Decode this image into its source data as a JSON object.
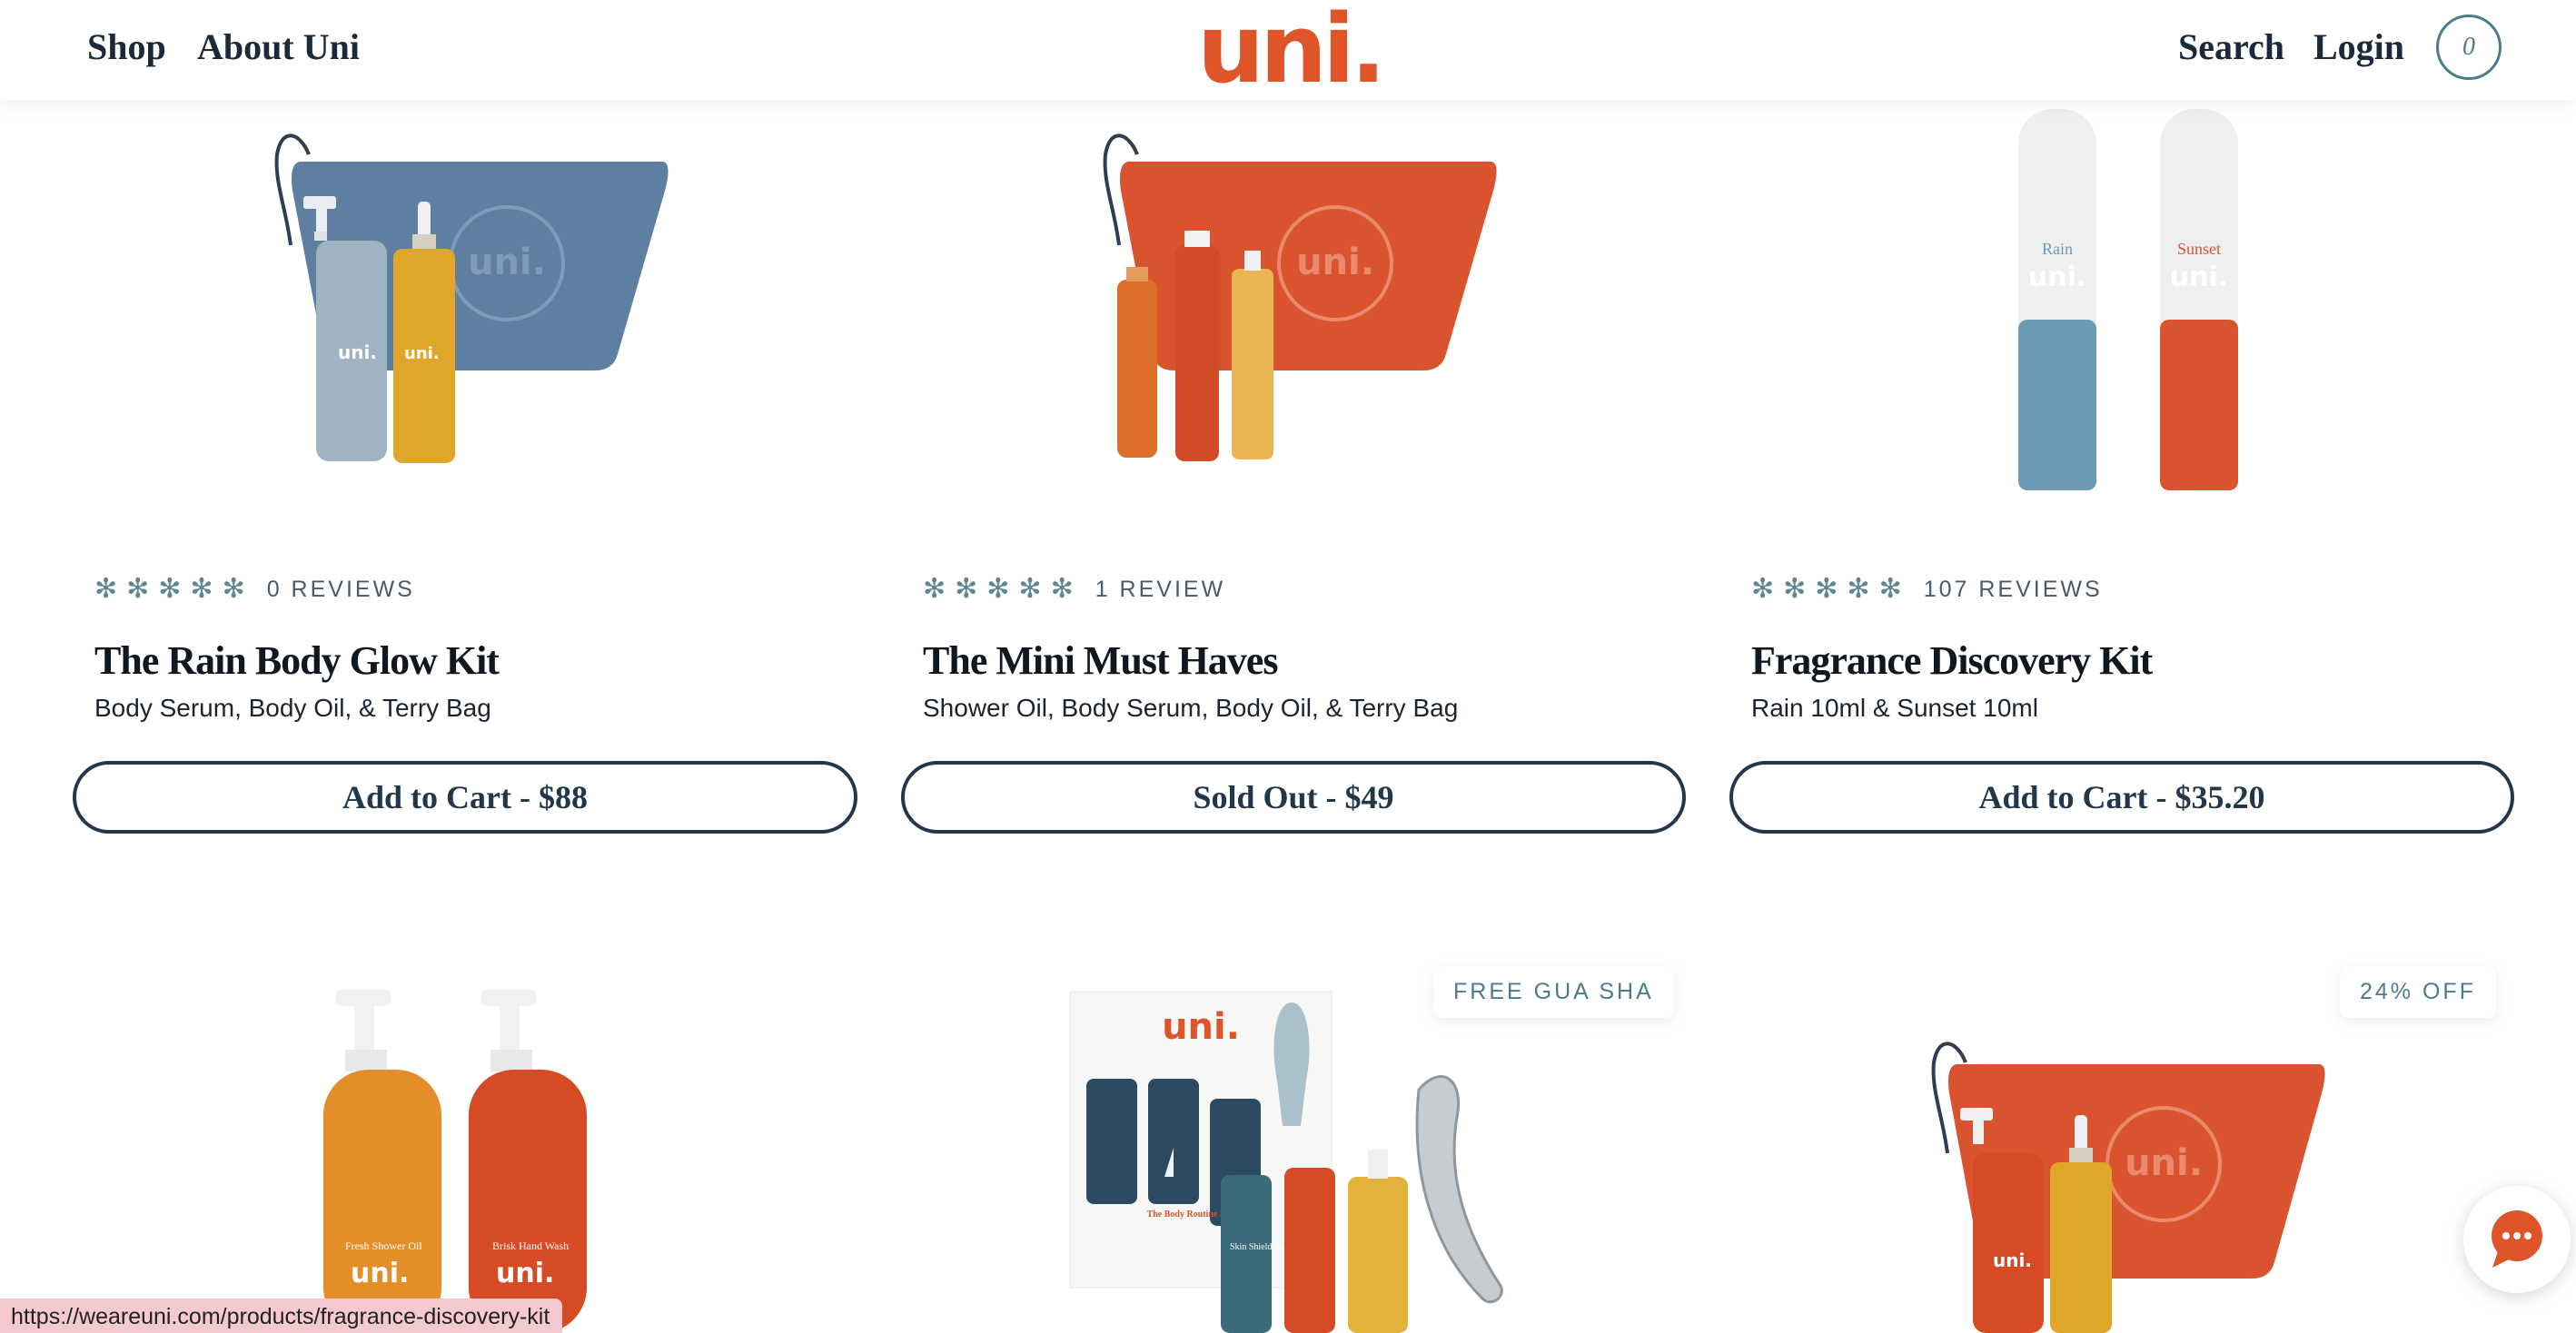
{
  "header": {
    "nav_left": [
      "Shop",
      "About Uni"
    ],
    "logo": "uni.",
    "nav_right": [
      "Search",
      "Login"
    ],
    "cart_count": "0"
  },
  "products": [
    {
      "title": "The Rain Body Glow Kit",
      "subtitle": "Body Serum, Body Oil, & Terry Bag",
      "reviews": "0 REVIEWS",
      "button": "Add to Cart - $88",
      "rating_stars": 5
    },
    {
      "title": "The Mini Must Haves",
      "subtitle": "Shower Oil, Body Serum, Body Oil, & Terry Bag",
      "reviews": "1 REVIEW",
      "button": "Sold Out - $49",
      "rating_stars": 5
    },
    {
      "title": "Fragrance Discovery Kit",
      "subtitle": "Rain 10ml & Sunset 10ml",
      "reviews": "107 REVIEWS",
      "button": "Add to Cart - $35.20",
      "rating_stars": 5
    }
  ],
  "row2_badges": [
    "FREE GUA SHA",
    "24% OFF"
  ],
  "product_image_text": {
    "bag_logo": "uni.",
    "bottle_logo": "uni.",
    "tube_left": "Rain",
    "tube_right": "Sunset",
    "bottle_orange_name": "Fresh Shower Oil",
    "bottle_red_name": "Brisk Hand Wash",
    "kit_card_title": "The Body Routine Kit - 3 Pi",
    "kit_logo": "uni.",
    "kit_bottle_teal": "Skin Shield Body Wash"
  },
  "status_bar": {
    "url": "https://weareuni.com/products/fragrance-discovery-kit"
  },
  "colors": {
    "brand_orange": "#e0542a",
    "ink": "#22374a",
    "accent_teal": "#4d7b8c",
    "star": "#5f8693"
  },
  "icons": {
    "star": "asterisk-star-icon",
    "chat": "chat-bubble-icon"
  }
}
